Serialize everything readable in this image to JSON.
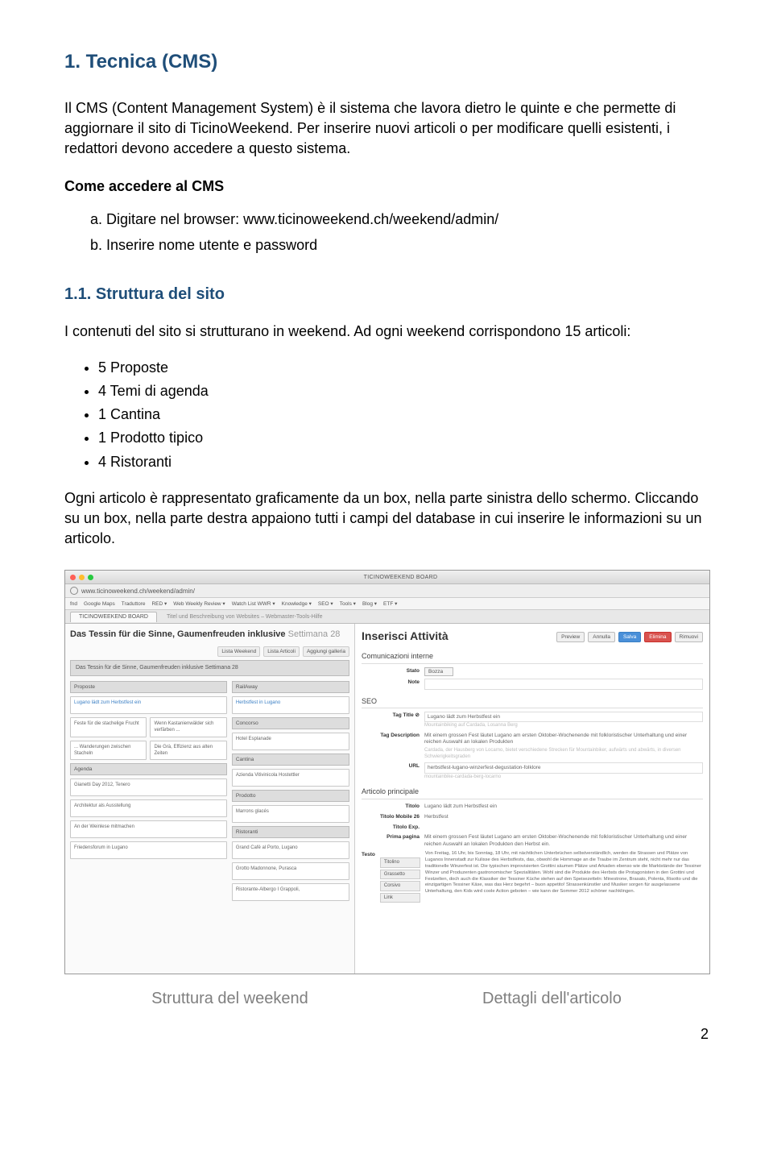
{
  "section1": {
    "title": "1. Tecnica (CMS)",
    "intro": "Il CMS (Content Management System) è il sistema che lavora dietro le quinte e che permette di aggiornare il sito di TicinoWeekend. Per inserire nuovi articoli o per modificare quelli esistenti, i redattori devono accedere a questo sistema.",
    "access_head": "Come accedere al CMS",
    "step_a": "a. Digitare nel browser: www.ticinoweekend.ch/weekend/admin/",
    "step_b": "b. Inserire nome utente e password"
  },
  "section11": {
    "title": "1.1. Struttura del sito",
    "p1": "I contenuti del sito si strutturano in weekend. Ad ogni weekend corrispondono 15 articoli:",
    "bullets": {
      "b1": "5 Proposte",
      "b2": "4 Temi di agenda",
      "b3": "1 Cantina",
      "b4": "1 Prodotto tipico",
      "b5": "4 Ristoranti"
    },
    "p2": "Ogni articolo è rappresentato graficamente da un box, nella parte sinistra dello schermo. Cliccando su un box, nella parte destra appaiono tutti i campi del database in cui inserire le informazioni su un articolo."
  },
  "screenshot": {
    "window_title": "TICINOWEEKEND BOARD",
    "url": "www.ticinoweekend.ch/weekend/admin/",
    "bookmarks": [
      "fnd",
      "Google Maps",
      "Traduttore",
      "RED ▾",
      "Web Weekly Review ▾",
      "Watch List WWR ▾",
      "Knowledge ▾",
      "SEO ▾",
      "Tools ▾",
      "Blog ▾",
      "ETF ▾"
    ],
    "tab_active": "TICINOWEEKEND BOARD",
    "tab_inactive": "Titel und Beschreibung von Websites – Webmaster-Tools-Hilfe",
    "left": {
      "title": "Das Tessin für die Sinne, Gaumenfreuden inklusive",
      "settimana": "Settimana 28",
      "mini_tabs": [
        "Lista Weekend",
        "Lista Articoli",
        "Aggiungi galleria"
      ],
      "head_box": "Das Tessin für die Sinne, Gaumenfreuden inklusive Settimana 28",
      "labels": {
        "proposte": "Proposte",
        "railaway": "RailAway",
        "concorso": "Concorso",
        "cantina": "Cantina",
        "prodotto": "Prodotto",
        "agenda": "Agenda",
        "ristoranti": "Ristoranti"
      },
      "proposte_cards": [
        "Lugano lädt zum Herbstfest ein",
        "Feste für die stachelige Frucht",
        "Wenn Kastanienwälder sich verfärben ...",
        "... Wanderungen zwischen Stacheln",
        "Die Grà, Effizienz aus alten Zeiten"
      ],
      "rail_card": "Herbstfest in Lugano",
      "concorso_card": "Hotel Esplanade",
      "cantina_card": "Azienda Vitivinicola Hostettler",
      "prodotto_card": "Marrons glacés",
      "agenda_cards": [
        "Gianetti Day 2012, Tenero",
        "Architektur als Ausstellung",
        "An der Weinlese mitmachen",
        "Friedensforum in Lugano"
      ],
      "ristoranti_cards": [
        "Grand Café al Porto, Lugano",
        "Grotto Madonnone, Purasca",
        "Ristorante-Albergo I Grappoli,"
      ]
    },
    "right": {
      "title": "Inserisci Attività",
      "buttons": [
        "Preview",
        "Annulla",
        "Salva",
        "Elimina",
        "Rimuovi"
      ],
      "sec_com": "Comunicazioni interne",
      "stato_lbl": "Stato",
      "stato_val": "Bozza",
      "note_lbl": "Note",
      "sec_seo": "SEO",
      "tagtitle_lbl": "Tag Title ⊘",
      "tagtitle_val": "Lugano lädt zum Herbstfest ein",
      "tagtitle_hint": "Mountainbiking auf Cardada, Losanna Berg",
      "tagdesc_lbl": "Tag Description",
      "tagdesc_val": "Mit einem grossen Fest läutet Lugano am ersten Oktober-Wochenende mit folkloristischer Unterhaltung und einer reichen Auswahl an lokalen Produkten",
      "tagdesc_hint": "Cardada, der Hausberg von Locarno, bietet verschiedene Strecken für Mountainbiker, aufwärts und abwärts, in diversen Schwierigkeitsgraden",
      "url_lbl": "URL",
      "url_val": "herbstfest-lugano-winzerfest-degustation-folklore",
      "url_hint": "mountainbike-cardada-berg-locarno",
      "sec_art": "Articolo principale",
      "titolo_lbl": "Titolo",
      "titolo_val": "Lugano lädt zum Herbstfest ein",
      "titolo26_lbl": "Titolo Mobile 26",
      "titolo26_val": "Herbstfest",
      "titoloexp_lbl": "Titolo Exp.",
      "prima_lbl": "Prima pagina",
      "prima_val": "Mit einem grossen Fest läutet Lugano am ersten Oktober-Wochenende mit folkloristischer Unterhaltung und einer reichen Auswahl an lokalen Produkten den Herbst ein.",
      "testo_lbl": "Testo",
      "testo_val": "Von Freitag, 16 Uhr, bis Sonntag, 18 Uhr, mit nächtlichen Unterbrüchen selbstverständlich, werden die Strassen und Plätze von Luganos Innenstadt zur Kulisse des Herbstfests, das, obwohl die Hommage an die Traube im Zentrum steht, nicht mehr nur das traditionelle Winzerfest ist. Die typischen improvisierten Grottini säumen Plätze und Arkaden ebenso wie die Marktstände der Tessiner Winzer und Produzenten gastronomischer Spezialitäten. Wohl sind die Produkte des Herbsts die Protagonisten in den Grottini und Festzelten, doch auch die Klassiker der Tessiner Küche stehen auf den Speisezetteln: Minestrone, Brasato, Polenta, Risotto und die einzigartigen Tessiner Käse, was das Herz begehrt – buon appetito! Strassenkünstler und Musiker sorgen für ausgelassene Unterhaltung, den Kids wird coole Action geboten – wie kann der Sommer 2012 schöner nachklingen.",
      "side_tabs": [
        "Titolino",
        "Grassetto",
        "Corsivo",
        "Link"
      ]
    }
  },
  "captions": {
    "left": "Struttura del weekend",
    "right": "Dettagli dell'articolo"
  },
  "page_number": "2"
}
